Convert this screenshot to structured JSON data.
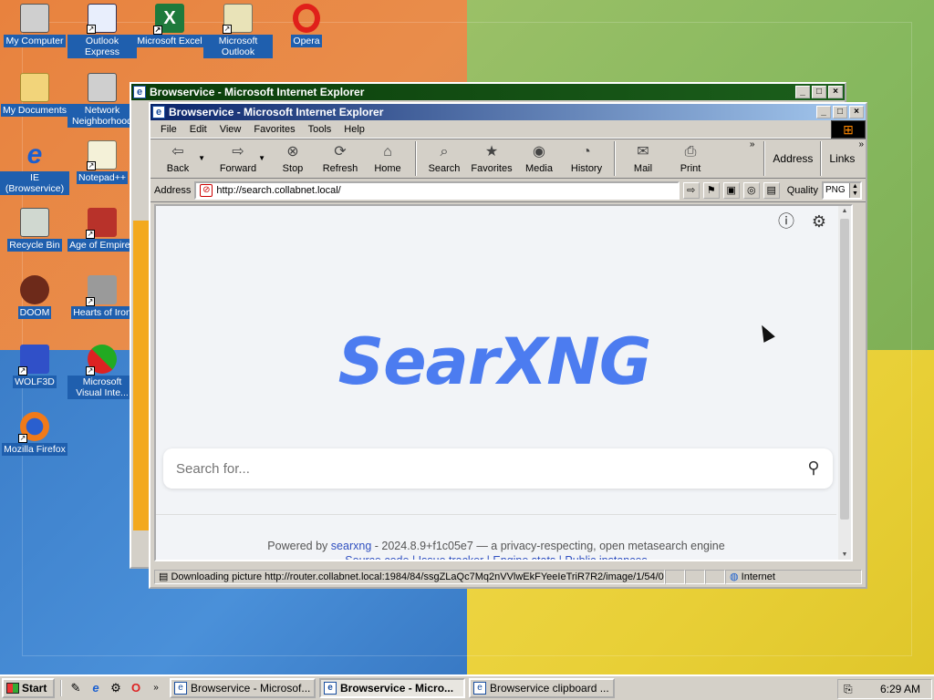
{
  "desktop": {
    "icons": [
      {
        "label": "My Computer",
        "icon": "computer-icon"
      },
      {
        "label": "Outlook Express",
        "icon": "outlook-express-icon"
      },
      {
        "label": "Microsoft Excel",
        "icon": "excel-icon"
      },
      {
        "label": "Microsoft Outlook",
        "icon": "outlook-icon"
      },
      {
        "label": "Opera",
        "icon": "opera-icon"
      },
      {
        "label": "My Documents",
        "icon": "folder-icon"
      },
      {
        "label": "Network Neighborhood",
        "icon": "network-icon"
      },
      {
        "label": "IE (Browservice)",
        "icon": "ie-icon"
      },
      {
        "label": "Notepad++",
        "icon": "notepad-icon"
      },
      {
        "label": "Recycle Bin",
        "icon": "recycle-bin-icon"
      },
      {
        "label": "Age of Empires",
        "icon": "age-of-empires-icon"
      },
      {
        "label": "DOOM",
        "icon": "doom-icon"
      },
      {
        "label": "Hearts of Iron",
        "icon": "hearts-of-iron-icon"
      },
      {
        "label": "WOLF3D",
        "icon": "wolf3d-icon"
      },
      {
        "label": "Microsoft Visual Inte...",
        "icon": "visual-interdev-icon"
      },
      {
        "label": "Mozilla Firefox",
        "icon": "firefox-icon"
      }
    ]
  },
  "back_window": {
    "title": "Browservice - Microsoft Internet Explorer"
  },
  "window": {
    "title": "Browservice - Microsoft Internet Explorer",
    "menu": [
      "File",
      "Edit",
      "View",
      "Favorites",
      "Tools",
      "Help"
    ],
    "toolbar": {
      "back": "Back",
      "forward": "Forward",
      "stop": "Stop",
      "refresh": "Refresh",
      "home": "Home",
      "search": "Search",
      "favorites": "Favorites",
      "media": "Media",
      "history": "History",
      "mail": "Mail",
      "print": "Print",
      "address": "Address",
      "links": "Links"
    },
    "address_label": "Address",
    "url": "http://search.collabnet.local/",
    "quality_label": "Quality",
    "quality_value": "PNG"
  },
  "page": {
    "logo": "SearXNG",
    "search_placeholder": "Search for...",
    "footer_prefix": "Powered by",
    "footer_link": "searxng",
    "footer_suffix": "- 2024.8.9+f1c05e7 — a privacy-respecting, open metasearch engine",
    "footer_links": "Source code | Issue tracker | Engine stats | Public instances"
  },
  "status": {
    "text": "Downloading picture http://router.collabnet.local:1984/84/ssgZLaQc7Mq2nVVlwEkFYeeIeTriR7R2/image/1/54/0",
    "zone": "Internet"
  },
  "taskbar": {
    "start": "Start",
    "tasks": [
      {
        "label": "Browservice - Microsof...",
        "active": false
      },
      {
        "label": "Browservice - Micro...",
        "active": true
      },
      {
        "label": "Browservice clipboard ...",
        "active": false
      }
    ],
    "clock": "6:29 AM"
  }
}
